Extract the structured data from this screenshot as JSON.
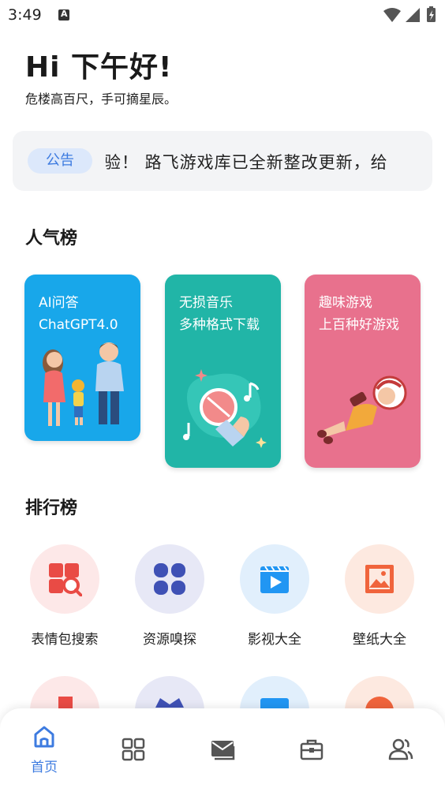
{
  "status_bar": {
    "time": "3:49"
  },
  "header": {
    "greeting": "Hi 下午好!",
    "subtitle": "危楼高百尺，手可摘星辰。"
  },
  "notice": {
    "tag": "公告",
    "text": "体验！  路飞游戏库已全新整改更新，给"
  },
  "popular": {
    "title": "人气榜",
    "cards": [
      {
        "line1": "AI问答",
        "line2": "ChatGPT4.0",
        "color": "#18a7ea"
      },
      {
        "line1": "无损音乐",
        "line2": "多种格式下载",
        "color": "#21b5a7"
      },
      {
        "line1": "趣味游戏",
        "line2": "上百种好游戏",
        "color": "#e8718d"
      }
    ]
  },
  "ranking": {
    "title": "排行榜",
    "items": [
      {
        "label": "表情包搜索",
        "icon": "emoji-search-icon",
        "bg": "#fde8e8",
        "fg": "#e94b45"
      },
      {
        "label": "资源嗅探",
        "icon": "grid-flower-icon",
        "bg": "#e7e8f6",
        "fg": "#3f51b5"
      },
      {
        "label": "影视大全",
        "icon": "video-icon",
        "bg": "#e1effc",
        "fg": "#2196f3"
      },
      {
        "label": "壁纸大全",
        "icon": "wallpaper-icon",
        "bg": "#fde9e0",
        "fg": "#f0643c"
      }
    ]
  },
  "bottom_nav": {
    "items": [
      {
        "label": "首页",
        "icon": "home-icon",
        "active": true
      },
      {
        "label": "",
        "icon": "apps-icon"
      },
      {
        "label": "",
        "icon": "mail-icon"
      },
      {
        "label": "",
        "icon": "toolbox-icon"
      },
      {
        "label": "",
        "icon": "user-group-icon"
      }
    ]
  }
}
